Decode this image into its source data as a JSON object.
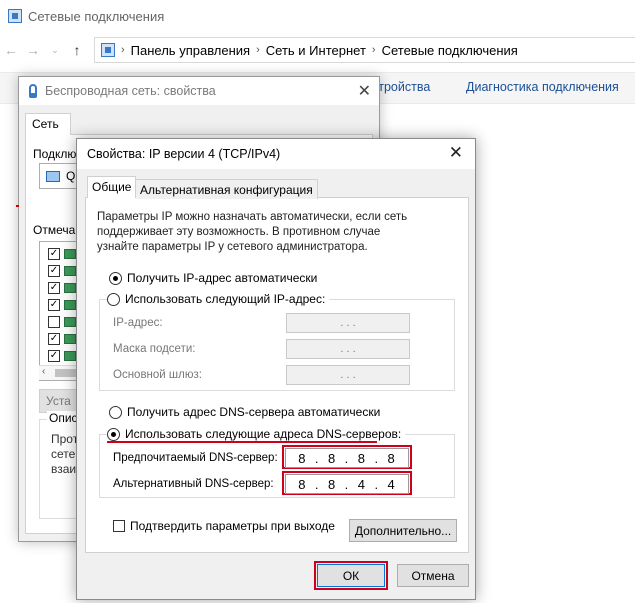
{
  "explorer": {
    "title": "Сетевые подключения",
    "breadcrumb": [
      "Панель управления",
      "Сеть и Интернет",
      "Сетевые подключения"
    ],
    "commands": {
      "settings_partial": "стройства",
      "diagnostics": "Диагностика подключения"
    }
  },
  "wireless_dialog": {
    "title": "Беспроводная сеть: свойства",
    "tab": "Сеть",
    "connect_label": "Подклю",
    "adapter_partial": "Q",
    "components_label": "Отмеча",
    "component_checks": [
      true,
      true,
      true,
      true,
      false,
      true,
      true
    ],
    "install_button": "Уста",
    "description_title": "Описа",
    "description_text": "Прот сете взаи"
  },
  "ipv4_dialog": {
    "title": "Свойства: IP версии 4 (TCP/IPv4)",
    "tabs": [
      "Общие",
      "Альтернативная конфигурация"
    ],
    "description": "Параметры IP можно назначать автоматически, если сеть поддерживает эту возможность. В противном случае узнайте параметры IP у сетевого администратора.",
    "ip_auto": "Получить IP-адрес автоматически",
    "ip_manual": "Использовать следующий IP-адрес:",
    "ip_address_label": "IP-адрес:",
    "subnet_label": "Маска подсети:",
    "gateway_label": "Основной шлюз:",
    "empty_ip": ". . .",
    "dns_auto": "Получить адрес DNS-сервера автоматически",
    "dns_manual": "Использовать следующие адреса DNS-серверов:",
    "preferred_dns_label": "Предпочитаемый DNS-сервер:",
    "preferred_dns_value": [
      "8",
      "8",
      "8",
      "8"
    ],
    "alternate_dns_label": "Альтернативный DNS-сервер:",
    "alternate_dns_value": [
      "8",
      "8",
      "4",
      "4"
    ],
    "validate_label": "Подтвердить параметры при выходе",
    "advanced_button": "Дополнительно...",
    "ok_button": "ОК",
    "cancel_button": "Отмена",
    "selected": {
      "ip": "auto",
      "dns": "manual",
      "validate": false
    },
    "highlight_color": "#d0001a"
  }
}
